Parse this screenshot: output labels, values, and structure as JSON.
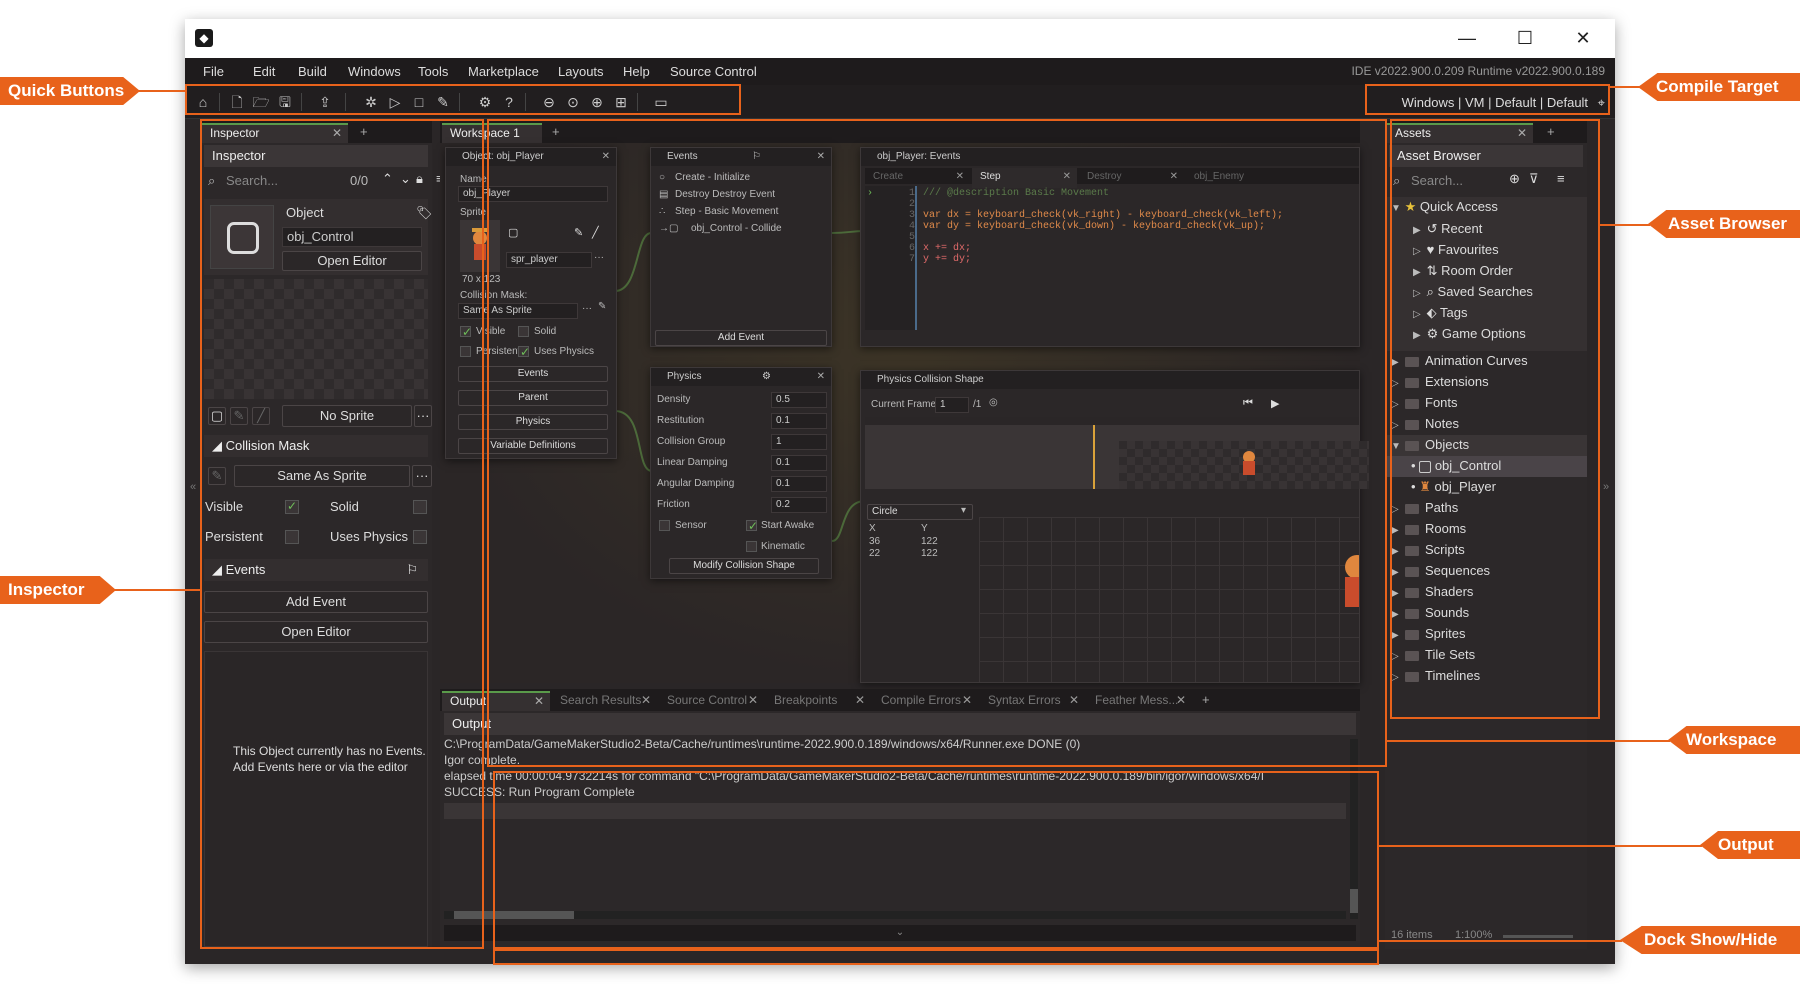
{
  "window": {
    "logo": "◆",
    "min": "—",
    "max": "☐",
    "close": "✕"
  },
  "menu": [
    "File",
    "Edit",
    "Build",
    "Windows",
    "Tools",
    "Marketplace",
    "Layouts",
    "Help",
    "Source Control"
  ],
  "version": "IDE v2022.900.0.209  Runtime v2022.900.0.189",
  "target": "Windows  |  VM  |  Default  |  Default",
  "inspector": {
    "tab": "Inspector",
    "tab_add": "+",
    "header": "Inspector",
    "search_placeholder": "Search...",
    "count": "0/0",
    "object_label": "Object",
    "object_name": "obj_Control",
    "open_editor": "Open Editor",
    "no_sprite": "No Sprite",
    "collision_mask": "Collision Mask",
    "same_as_sprite": "Same As Sprite",
    "visible": "Visible",
    "solid": "Solid",
    "persistent": "Persistent",
    "uses_physics": "Uses Physics",
    "events": "Events",
    "add_event": "Add Event",
    "open_editor2": "Open Editor",
    "no_events_1": "This Object currently has no Events.",
    "no_events_2": "Add Events here or via the editor",
    "more": "···"
  },
  "workspace": {
    "tab": "Workspace 1",
    "tab_add": "+",
    "obj_node": {
      "title": "Object: obj_Player",
      "name_label": "Name:",
      "name": "obj_Player",
      "sprite_label": "Sprite:",
      "sprite_size": "70 x 123",
      "sprite_name": "spr_player",
      "collision_label": "Collision Mask:",
      "collision": "Same As Sprite",
      "visible": "Visible",
      "solid": "Solid",
      "persistent": "Persistent",
      "uses_physics": "Uses Physics",
      "events_btn": "Events",
      "parent_btn": "Parent",
      "physics_btn": "Physics",
      "vardefs_btn": "Variable Definitions"
    },
    "events_node": {
      "title": "Events",
      "items": [
        "Create - Initialize",
        "Destroy  Destroy Event",
        "Step - Basic Movement",
        "obj_Control - Collide"
      ],
      "add_event": "Add Event"
    },
    "code_node": {
      "title": "obj_Player: Events",
      "tabs": [
        "Create",
        "Step",
        "Destroy",
        "obj_Enemy"
      ],
      "lines": [
        "1",
        "2",
        "3",
        "4",
        "5",
        "6",
        "7"
      ],
      "code": [
        "/// @description Basic Movement",
        "",
        "var dx = keyboard_check(vk_right) - keyboard_check(vk_left);",
        "var dy = keyboard_check(vk_down) - keyboard_check(vk_up);",
        "",
        "x += dx;",
        "y += dy;"
      ]
    },
    "physics_node": {
      "title": "Physics",
      "rows": [
        [
          "Density",
          "0.5"
        ],
        [
          "Restitution",
          "0.1"
        ],
        [
          "Collision Group",
          "1"
        ],
        [
          "Linear Damping",
          "0.1"
        ],
        [
          "Angular Damping",
          "0.1"
        ],
        [
          "Friction",
          "0.2"
        ]
      ],
      "sensor": "Sensor",
      "start_awake": "Start Awake",
      "kinematic": "Kinematic",
      "modify": "Modify Collision Shape"
    },
    "shape_node": {
      "title": "Physics Collision Shape",
      "frame_label": "Current Frame:",
      "frame": "1",
      "frame_of": "/1",
      "shape": "Circle",
      "col_x": "X",
      "col_y": "Y",
      "points": [
        [
          "36",
          "122"
        ],
        [
          "22",
          "122"
        ]
      ]
    }
  },
  "output": {
    "tabs": [
      "Output",
      "Search Results",
      "Source Control",
      "Breakpoints",
      "Compile Errors",
      "Syntax Errors",
      "Feather Mess..."
    ],
    "tab_add": "+",
    "header": "Output",
    "lines": [
      "C:\\ProgramData/GameMakerStudio2-Beta/Cache/runtimes\\runtime-2022.900.0.189/windows/x64/Runner.exe DONE (0)",
      "Igor complete.",
      "elapsed time 00:00:04.9732214s for command \"C:\\ProgramData/GameMakerStudio2-Beta/Cache/runtimes\\runtime-2022.900.0.189/bin/igor/windows/x64/I",
      "SUCCESS: Run Program Complete"
    ]
  },
  "assets": {
    "tab": "Assets",
    "tab_add": "+",
    "header": "Asset Browser",
    "search_placeholder": "Search...",
    "quick_access": "Quick Access",
    "quick_items": [
      "Recent",
      "Favourites",
      "Room Order",
      "Saved Searches",
      "Tags",
      "Game Options"
    ],
    "folders_a": [
      "Animation Curves",
      "Extensions",
      "Fonts",
      "Notes"
    ],
    "objects": "Objects",
    "objects_children": [
      "obj_Control",
      "obj_Player"
    ],
    "folders_b": [
      "Paths",
      "Rooms",
      "Scripts",
      "Sequences",
      "Shaders",
      "Sounds",
      "Sprites",
      "Tile Sets",
      "Timelines"
    ],
    "footer_items": "16 items",
    "footer_zoom": "1:100%"
  },
  "callouts": {
    "quick_buttons": "Quick Buttons",
    "compile_target": "Compile Target",
    "asset_browser": "Asset Browser",
    "inspector": "Inspector",
    "workspace": "Workspace",
    "output": "Output",
    "dock": "Dock Show/Hide"
  },
  "colors": {
    "accent": "#e8621b",
    "tab_green": "#5a9a4a",
    "bg": "#2a2627"
  }
}
